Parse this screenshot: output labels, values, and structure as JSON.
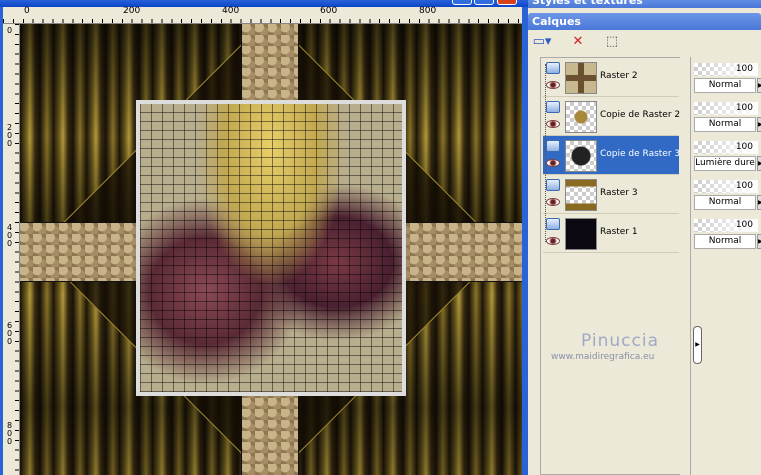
{
  "ruler": {
    "h": [
      "0",
      "200",
      "400",
      "600",
      "800"
    ],
    "v": [
      "0",
      "200",
      "400",
      "600",
      "800"
    ]
  },
  "panel": {
    "styles_title": "Styles et textures",
    "layers_title": "Calques"
  },
  "toolbar": {
    "new_layer": "new-layer-icon",
    "delete": "delete-layer-icon",
    "edit_selection": "edit-selection-icon"
  },
  "layers": [
    {
      "name": "Raster 2",
      "opacity": "100",
      "blend": "Normal",
      "selected": false
    },
    {
      "name": "Copie de Raster 2",
      "opacity": "100",
      "blend": "Normal",
      "selected": false
    },
    {
      "name": "Copie de Raster 3",
      "opacity": "100",
      "blend": "Lumière dure",
      "selected": true
    },
    {
      "name": "Raster 3",
      "opacity": "100",
      "blend": "Normal",
      "selected": false
    },
    {
      "name": "Raster 1",
      "opacity": "100",
      "blend": "Normal",
      "selected": false
    }
  ],
  "watermark": {
    "name": "Pinuccia",
    "url": "www.maidiregrafica.eu"
  },
  "colors": {
    "accent": "#316ac5",
    "titlebar": "#2a62d8"
  }
}
